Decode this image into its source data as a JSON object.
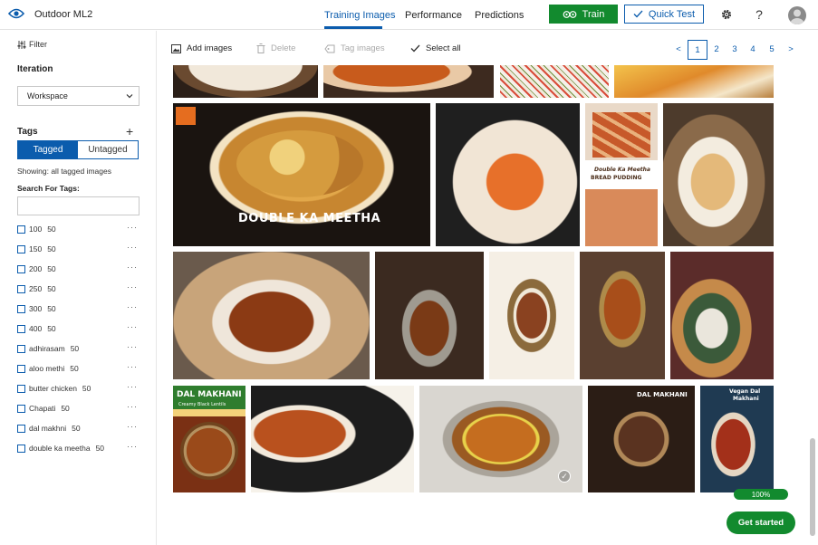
{
  "header": {
    "project_name": "Outdoor ML2",
    "tabs": [
      {
        "label": "Training Images",
        "active": true
      },
      {
        "label": "Performance",
        "active": false
      },
      {
        "label": "Predictions",
        "active": false
      }
    ],
    "train_label": "Train",
    "quick_test_label": "Quick Test",
    "icons": [
      "eye-icon",
      "gear-icon",
      "help-icon",
      "avatar"
    ]
  },
  "sidebar": {
    "filter_label": "Filter",
    "iteration_heading": "Iteration",
    "iteration_selected": "Workspace",
    "tags_heading": "Tags",
    "tagged_label": "Tagged",
    "untagged_label": "Untagged",
    "showing_text": "Showing: all tagged images",
    "search_label": "Search For Tags:",
    "search_value": "",
    "tags": [
      {
        "name": "100",
        "count": "50"
      },
      {
        "name": "150",
        "count": "50"
      },
      {
        "name": "200",
        "count": "50"
      },
      {
        "name": "250",
        "count": "50"
      },
      {
        "name": "300",
        "count": "50"
      },
      {
        "name": "400",
        "count": "50"
      },
      {
        "name": "adhirasam",
        "count": "50"
      },
      {
        "name": "aloo methi",
        "count": "50"
      },
      {
        "name": "butter chicken",
        "count": "50"
      },
      {
        "name": "Chapati",
        "count": "50"
      },
      {
        "name": "dal makhni",
        "count": "50"
      },
      {
        "name": "double ka meetha",
        "count": "50"
      }
    ],
    "more_symbol": "···"
  },
  "toolbar": {
    "add_images": "Add images",
    "delete": "Delete",
    "tag_images": "Tag images",
    "select_all": "Select all"
  },
  "pagination": {
    "prev": "<",
    "pages": [
      "1",
      "2",
      "3",
      "4",
      "5"
    ],
    "current": "1",
    "next": ">"
  },
  "images": {
    "captions": {
      "double_ka_meetha": "DOUBLE KA MEETHA",
      "bread_pudding_title": "Double Ka Meetha",
      "bread_pudding_sub": "BREAD PUDDING",
      "dal_makhani": "DAL MAKHANI",
      "creamy_black_lentils": "Creamy Black Lentils",
      "dal_makhani_2": "DAL MAKHANI",
      "vegan_dal": "Vegan Dal",
      "makhani": "Makhani"
    },
    "selected_check": "✓"
  },
  "status": {
    "progress_label": "100%",
    "progress_value": 100,
    "get_started_label": "Get started"
  },
  "colors": {
    "accent": "#0b5cad",
    "train_green": "#128a2e"
  }
}
